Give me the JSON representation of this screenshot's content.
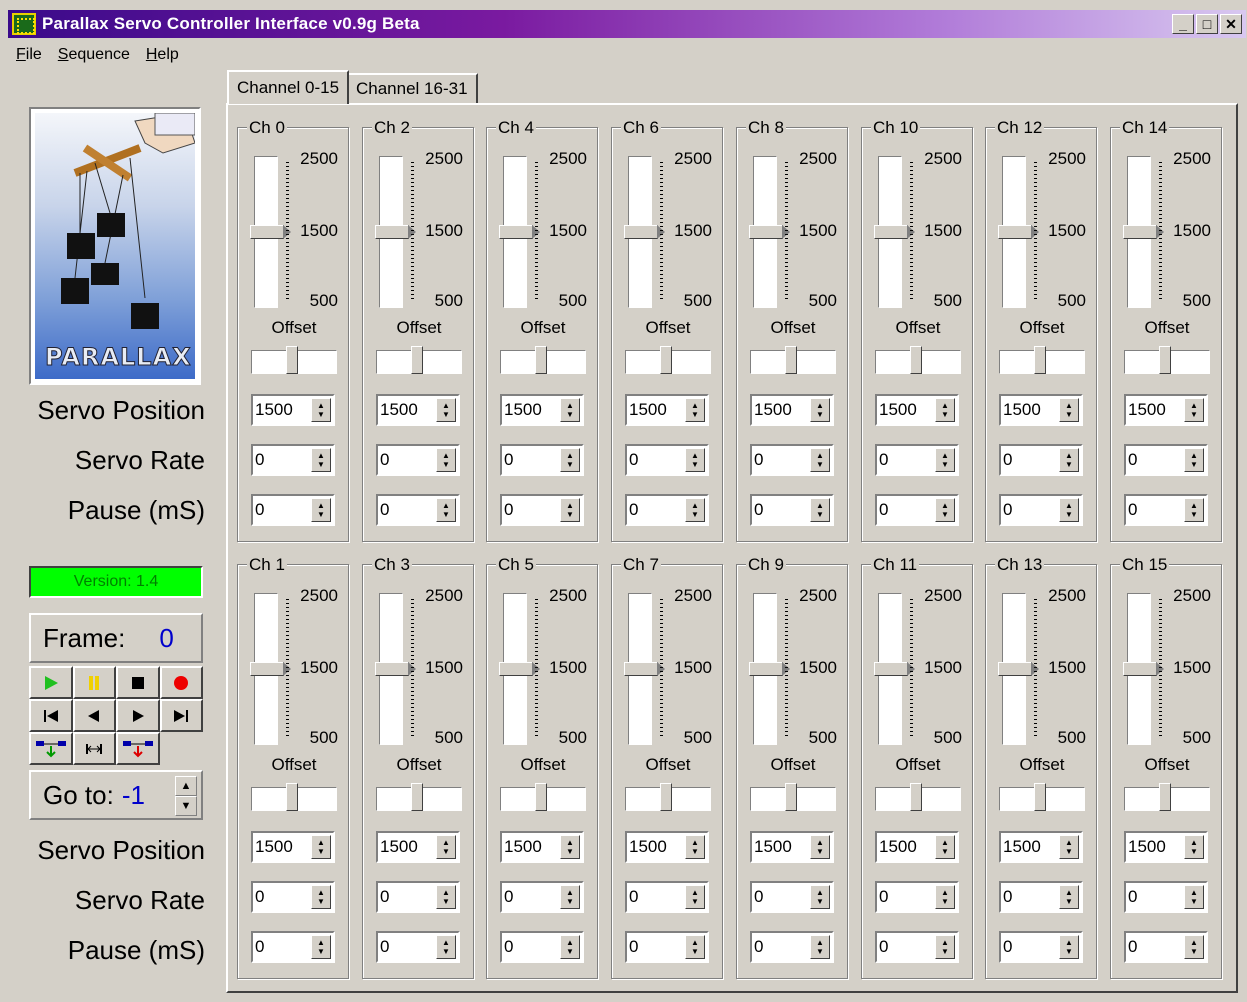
{
  "window": {
    "title": "Parallax Servo Controller Interface v0.9g Beta",
    "minimize": "_",
    "maximize": "□",
    "close": "✕"
  },
  "menu": {
    "file_rest": "ile",
    "file_key": "F",
    "sequence_rest": "equence",
    "sequence_key": "S",
    "help_rest": "elp",
    "help_key": "H"
  },
  "tabs": [
    {
      "label": "Channel 0-15",
      "active": true
    },
    {
      "label": "Channel 16-31",
      "active": false
    }
  ],
  "left": {
    "logo_text": "PARALLAX",
    "top_labels": {
      "position": "Servo Position",
      "rate": "Servo Rate",
      "pause": "Pause (mS)"
    },
    "bottom_labels": {
      "position": "Servo Position",
      "rate": "Servo Rate",
      "pause": "Pause (mS)"
    },
    "version": "Version: 1.4",
    "frame_label": "Frame:",
    "frame_value": "0",
    "goto_label": "Go to:",
    "goto_value": "-1",
    "colors": {
      "version_bg": "#00ff00",
      "version_text": "#008000",
      "value_blue": "#0000cc"
    }
  },
  "slider_scale": {
    "max": "2500",
    "mid": "1500",
    "min": "500"
  },
  "offset_label": "Offset",
  "channels": [
    {
      "name": "Ch 0",
      "position": "1500",
      "rate": "0",
      "pause": "0",
      "slider_value": 1500
    },
    {
      "name": "Ch 2",
      "position": "1500",
      "rate": "0",
      "pause": "0",
      "slider_value": 1500
    },
    {
      "name": "Ch 4",
      "position": "1500",
      "rate": "0",
      "pause": "0",
      "slider_value": 1500
    },
    {
      "name": "Ch 6",
      "position": "1500",
      "rate": "0",
      "pause": "0",
      "slider_value": 1500
    },
    {
      "name": "Ch 8",
      "position": "1500",
      "rate": "0",
      "pause": "0",
      "slider_value": 1500
    },
    {
      "name": "Ch 10",
      "position": "1500",
      "rate": "0",
      "pause": "0",
      "slider_value": 1500
    },
    {
      "name": "Ch 12",
      "position": "1500",
      "rate": "0",
      "pause": "0",
      "slider_value": 1500
    },
    {
      "name": "Ch 14",
      "position": "1500",
      "rate": "0",
      "pause": "0",
      "slider_value": 1500
    },
    {
      "name": "Ch 1",
      "position": "1500",
      "rate": "0",
      "pause": "0",
      "slider_value": 1500
    },
    {
      "name": "Ch 3",
      "position": "1500",
      "rate": "0",
      "pause": "0",
      "slider_value": 1500
    },
    {
      "name": "Ch 5",
      "position": "1500",
      "rate": "0",
      "pause": "0",
      "slider_value": 1500
    },
    {
      "name": "Ch 7",
      "position": "1500",
      "rate": "0",
      "pause": "0",
      "slider_value": 1500
    },
    {
      "name": "Ch 9",
      "position": "1500",
      "rate": "0",
      "pause": "0",
      "slider_value": 1500
    },
    {
      "name": "Ch 11",
      "position": "1500",
      "rate": "0",
      "pause": "0",
      "slider_value": 1500
    },
    {
      "name": "Ch 13",
      "position": "1500",
      "rate": "0",
      "pause": "0",
      "slider_value": 1500
    },
    {
      "name": "Ch 15",
      "position": "1500",
      "rate": "0",
      "pause": "0",
      "slider_value": 1500
    }
  ]
}
